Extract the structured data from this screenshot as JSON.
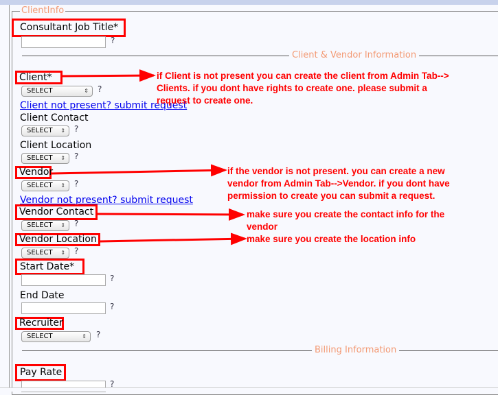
{
  "legend": "ClientInfo",
  "sections": {
    "client_vendor": "Client & Vendor Information",
    "billing": "Billing Information"
  },
  "fields": {
    "job_title": "Consultant Job Title*",
    "client": "Client*",
    "client_contact": "Client Contact",
    "client_location": "Client Location",
    "vendor": "Vendor",
    "vendor_contact": "Vendor Contact",
    "vendor_location": "Vendor Location",
    "start_date": "Start Date*",
    "end_date": "End Date",
    "recruiter": "Recruiter",
    "pay_rate": "Pay Rate"
  },
  "select_value": "SELECT",
  "help": "?",
  "links": {
    "client": "Client not present? submit request",
    "vendor": "Vendor not present? submit request"
  },
  "notes": {
    "client": [
      "if Client is not present you can create the client from Admin Tab-->",
      "Clients. if you dont have rights to create one. please submit a",
      "request to create one."
    ],
    "vendor": [
      "if the vendor is not present. you can create a new",
      "vendor from Admin Tab-->Vendor. if you dont have",
      "permission to create you can submit a request."
    ],
    "vendor_contact": [
      "make sure you create the contact info for the",
      "vendor"
    ],
    "vendor_location": [
      "make sure you create the location info"
    ]
  },
  "colors": {
    "annotation": "#ff0000",
    "legend": "#f39a74",
    "link": "#0000ee"
  }
}
